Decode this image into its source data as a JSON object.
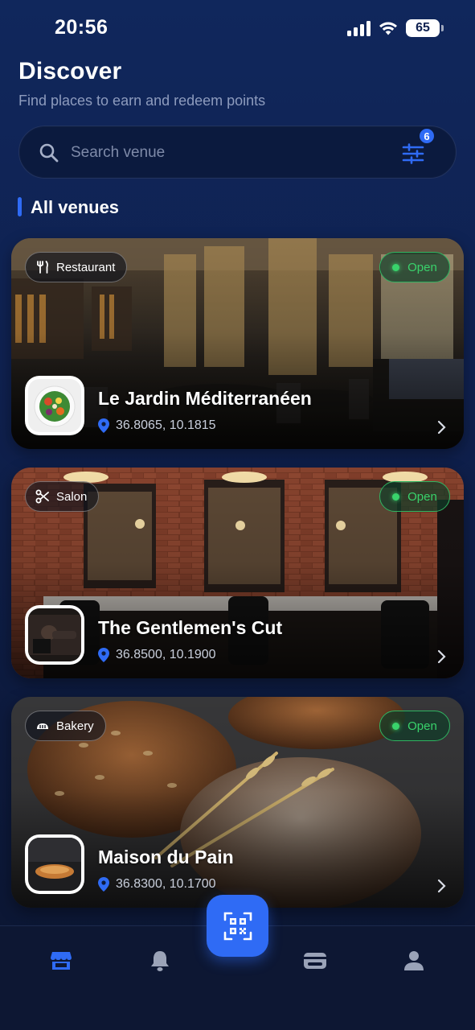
{
  "status_bar": {
    "time": "20:56",
    "battery": "65"
  },
  "header": {
    "title": "Discover",
    "subtitle": "Find places to earn and redeem points"
  },
  "search": {
    "placeholder": "Search venue",
    "filter_count": "6"
  },
  "section": {
    "title": "All venues"
  },
  "venues": [
    {
      "category": "Restaurant",
      "category_icon": "fork-knife-icon",
      "status": "Open",
      "name": "Le Jardin Méditerranéen",
      "coords": "36.8065, 10.1815"
    },
    {
      "category": "Salon",
      "category_icon": "scissors-icon",
      "status": "Open",
      "name": "The Gentlemen's Cut",
      "coords": "36.8500, 10.1900"
    },
    {
      "category": "Bakery",
      "category_icon": "bread-icon",
      "status": "Open",
      "name": "Maison du Pain",
      "coords": "36.8300, 10.1700"
    }
  ],
  "nav": {
    "items": [
      "store-icon",
      "bell-icon",
      "qr-scan-icon",
      "wallet-icon",
      "user-icon"
    ],
    "active": "store-icon"
  },
  "colors": {
    "accent": "#2f6bf5",
    "open_green": "#39d26b",
    "background": "#0f2150"
  }
}
